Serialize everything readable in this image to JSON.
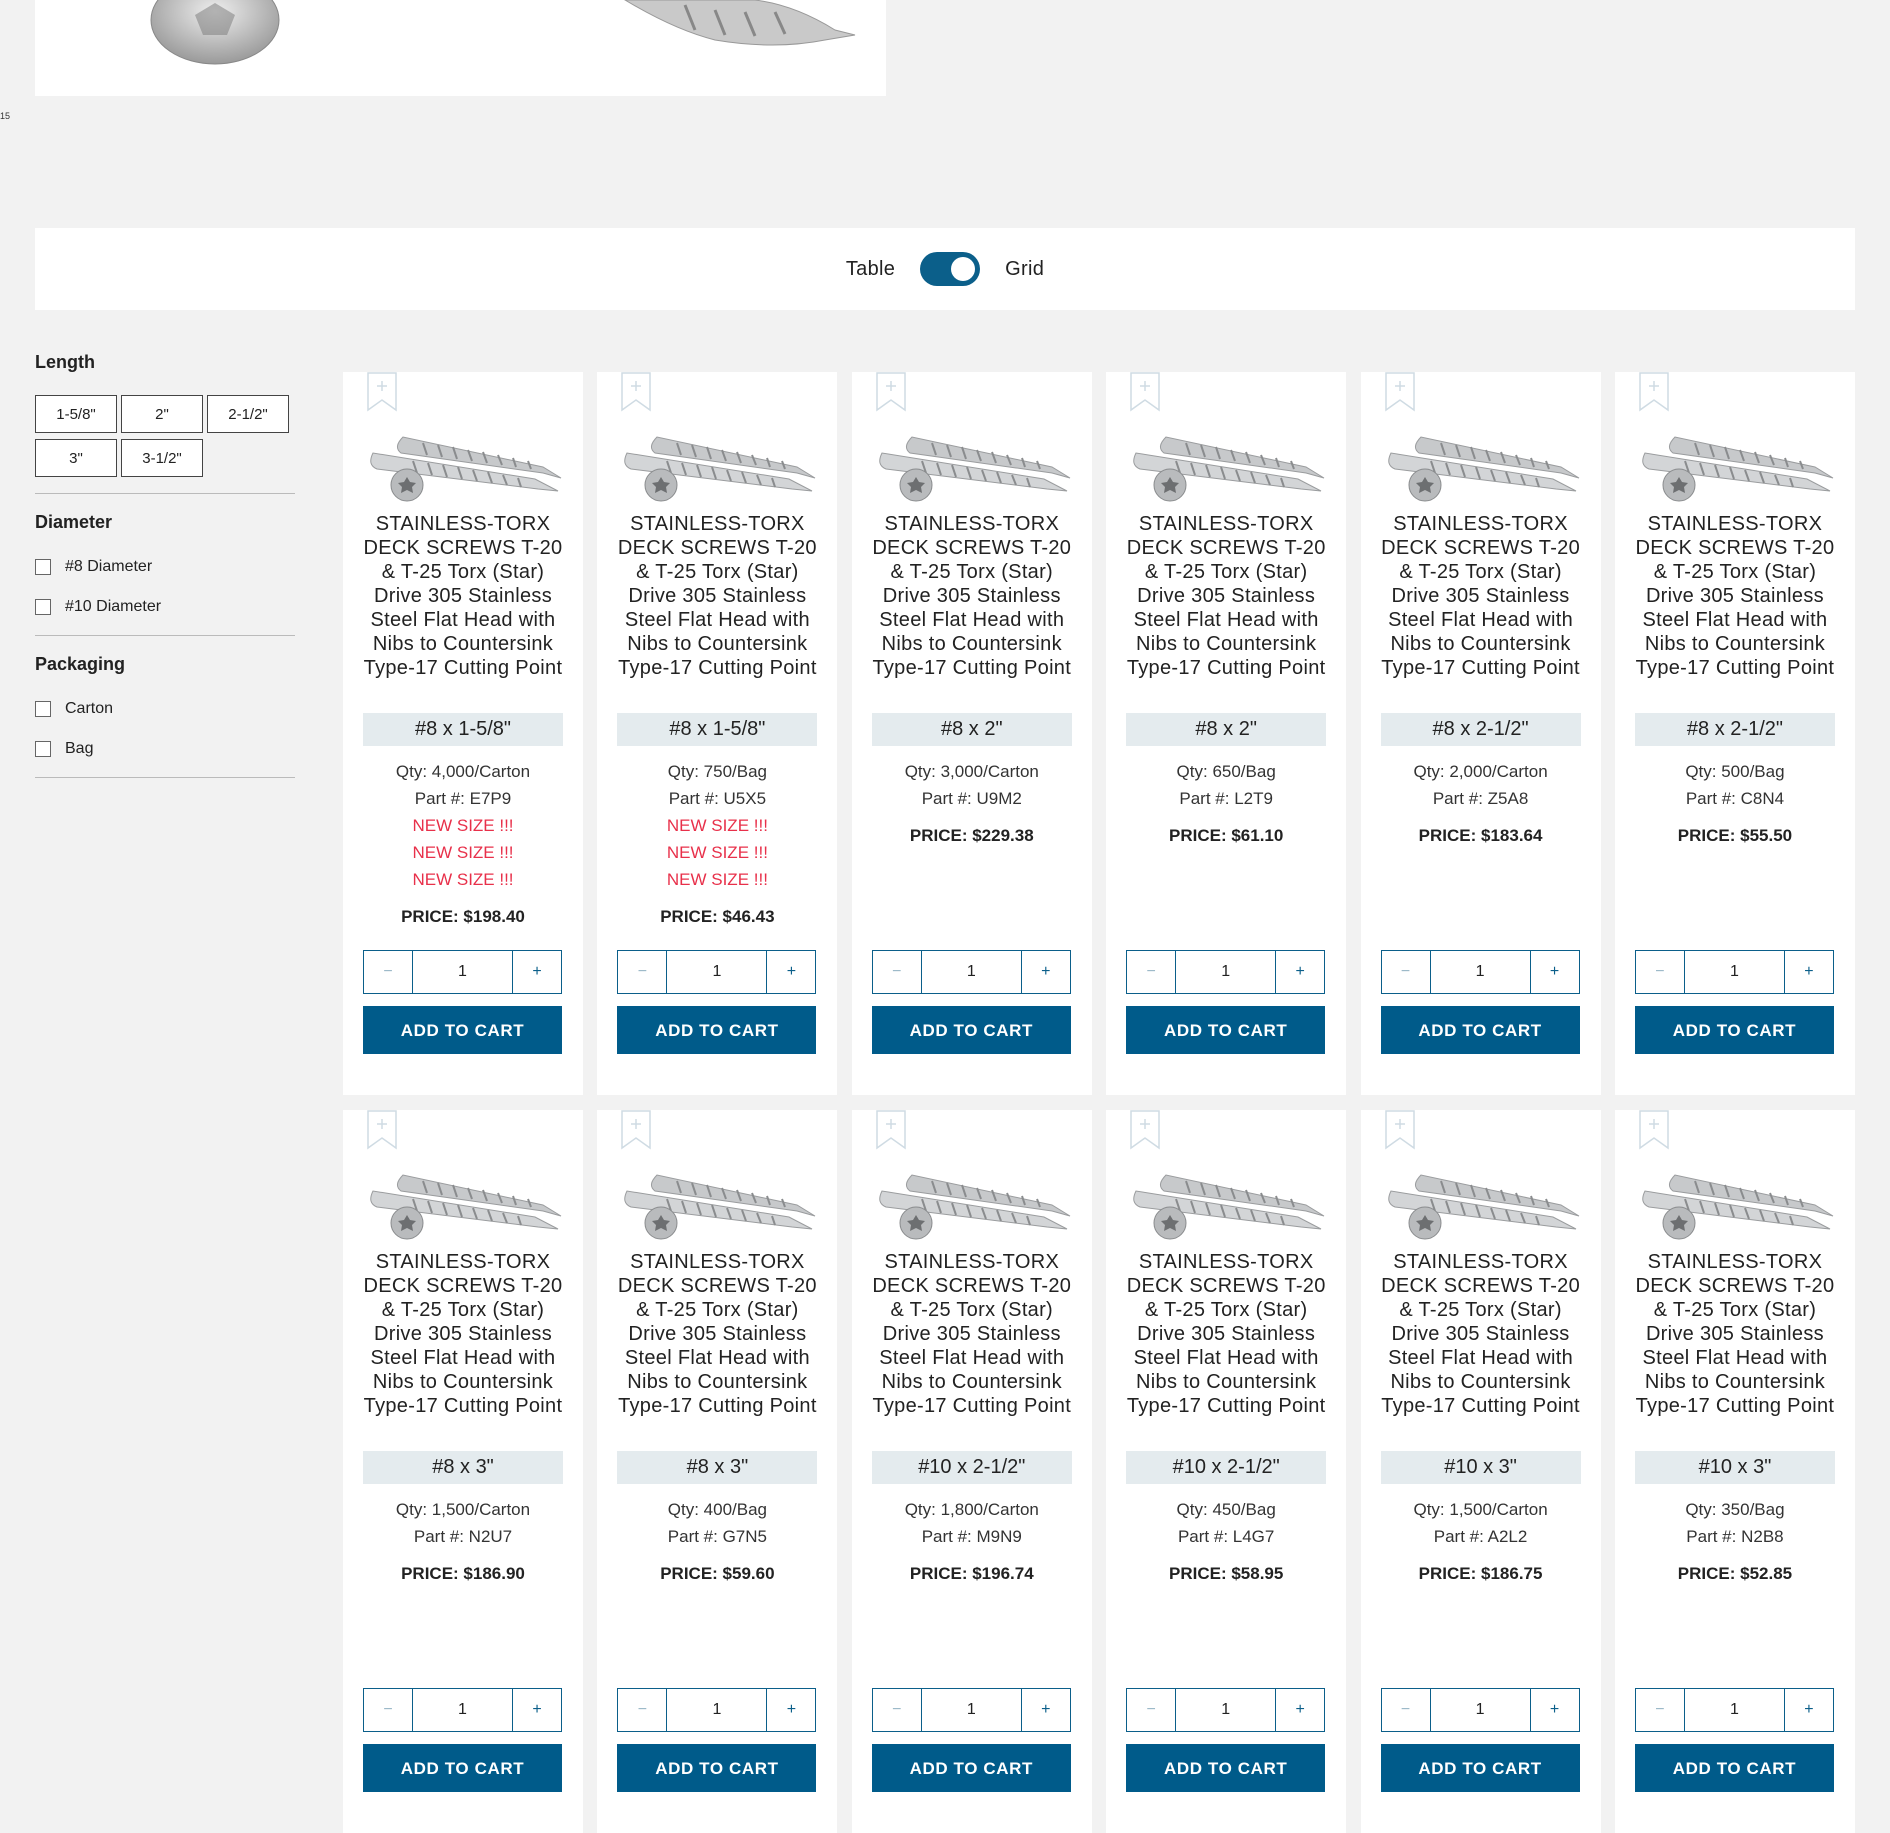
{
  "page_index": "15",
  "view_toggle": {
    "left_label": "Table",
    "right_label": "Grid"
  },
  "filters": {
    "length": {
      "title": "Length",
      "options": [
        "1-5/8\"",
        "2\"",
        "2-1/2\"",
        "3\"",
        "3-1/2\""
      ]
    },
    "diameter": {
      "title": "Diameter",
      "options": [
        "#8 Diameter",
        "#10 Diameter"
      ]
    },
    "packaging": {
      "title": "Packaging",
      "options": [
        "Carton",
        "Bag"
      ]
    }
  },
  "product_title": "STAINLESS-TORX DECK SCREWS T-20 & T-25 Torx (Star) Drive 305 Stainless Steel Flat Head with Nibs to Countersink Type-17 Cutting Point",
  "labels": {
    "qty_prefix": "Qty:",
    "part_prefix": "Part #:",
    "price_prefix": "PRICE:",
    "add_to_cart": "ADD TO CART",
    "new_size": "NEW SIZE !!!"
  },
  "colors": {
    "accent": "#005b8a",
    "new_size": "#e8304a",
    "size_bg": "#e4ebee"
  },
  "products": [
    {
      "size": "#8 x 1-5/8\"",
      "qty": "4,000/Carton",
      "part": "E7P9",
      "notes": [
        "NEW SIZE !!!",
        "NEW SIZE !!!",
        "NEW SIZE !!!"
      ],
      "price": "$198.40",
      "quantity": "1"
    },
    {
      "size": "#8 x 1-5/8\"",
      "qty": "750/Bag",
      "part": "U5X5",
      "notes": [
        "NEW SIZE !!!",
        "NEW SIZE !!!",
        "NEW SIZE !!!"
      ],
      "price": "$46.43",
      "quantity": "1"
    },
    {
      "size": "#8 x 2\"",
      "qty": "3,000/Carton",
      "part": "U9M2",
      "notes": [],
      "price": "$229.38",
      "quantity": "1"
    },
    {
      "size": "#8 x 2\"",
      "qty": "650/Bag",
      "part": "L2T9",
      "notes": [],
      "price": "$61.10",
      "quantity": "1"
    },
    {
      "size": "#8 x 2-1/2\"",
      "qty": "2,000/Carton",
      "part": "Z5A8",
      "notes": [],
      "price": "$183.64",
      "quantity": "1"
    },
    {
      "size": "#8 x 2-1/2\"",
      "qty": "500/Bag",
      "part": "C8N4",
      "notes": [],
      "price": "$55.50",
      "quantity": "1"
    },
    {
      "size": "#8 x 3\"",
      "qty": "1,500/Carton",
      "part": "N2U7",
      "notes": [],
      "price": "$186.90",
      "quantity": "1"
    },
    {
      "size": "#8 x 3\"",
      "qty": "400/Bag",
      "part": "G7N5",
      "notes": [],
      "price": "$59.60",
      "quantity": "1"
    },
    {
      "size": "#10 x 2-1/2\"",
      "qty": "1,800/Carton",
      "part": "M9N9",
      "notes": [],
      "price": "$196.74",
      "quantity": "1"
    },
    {
      "size": "#10 x 2-1/2\"",
      "qty": "450/Bag",
      "part": "L4G7",
      "notes": [],
      "price": "$58.95",
      "quantity": "1"
    },
    {
      "size": "#10 x 3\"",
      "qty": "1,500/Carton",
      "part": "A2L2",
      "notes": [],
      "price": "$186.75",
      "quantity": "1"
    },
    {
      "size": "#10 x 3\"",
      "qty": "350/Bag",
      "part": "N2B8",
      "notes": [],
      "price": "$52.85",
      "quantity": "1"
    }
  ]
}
